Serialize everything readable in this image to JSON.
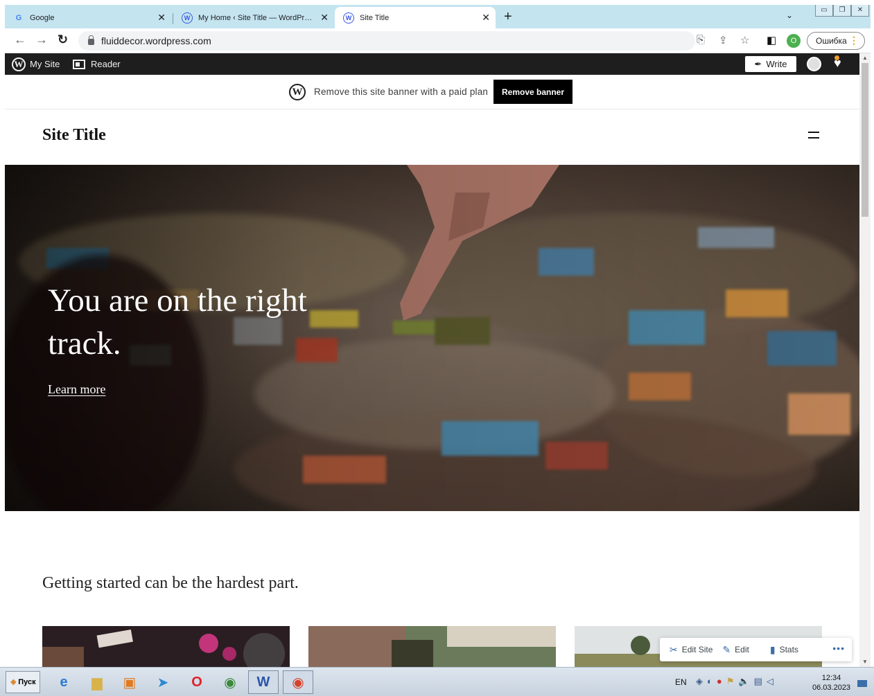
{
  "browser": {
    "tabs": [
      {
        "title": "Google",
        "favicon": "google-g-icon"
      },
      {
        "title": "My Home ‹ Site Title — WordPress.com",
        "favicon": "wordpress-icon"
      },
      {
        "title": "Site Title",
        "favicon": "wordpress-icon",
        "active": true
      }
    ],
    "new_tab": "+",
    "url": "fluiddecor.wordpress.com",
    "profile_initial": "O",
    "error_button": "Ошибка"
  },
  "admin_bar": {
    "my_site": "My Site",
    "reader": "Reader",
    "write": "Write"
  },
  "banner": {
    "text": "Remove this site banner with a paid plan",
    "button": "Remove banner"
  },
  "site": {
    "title": "Site Title"
  },
  "hero": {
    "title": "You are on the right track.",
    "link": "Learn more"
  },
  "section": {
    "heading": "Getting started can be the hardest part."
  },
  "edit_bar": {
    "edit_site": "Edit Site",
    "edit": "Edit",
    "stats": "Stats",
    "more": "•••"
  },
  "taskbar": {
    "start": "Пуск",
    "lang": "EN",
    "time": "12:34",
    "date": "06.03.2023"
  }
}
